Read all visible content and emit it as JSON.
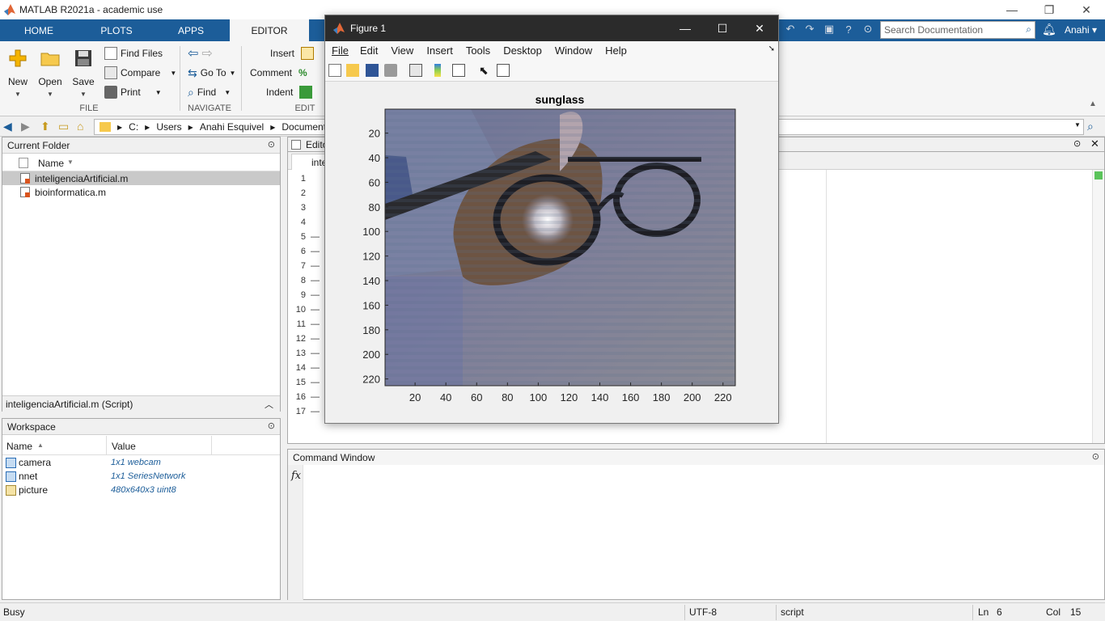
{
  "app": {
    "title": "MATLAB R2021a - academic use"
  },
  "window_controls": {
    "minimize": "—",
    "restore": "❐",
    "close": "✕"
  },
  "ribbon_tabs": [
    {
      "label": "HOME"
    },
    {
      "label": "PLOTS"
    },
    {
      "label": "APPS"
    },
    {
      "label": "EDITOR"
    }
  ],
  "search": {
    "placeholder": "Search Documentation"
  },
  "user": {
    "name": "Anahi",
    "caret": "▾"
  },
  "ribbon": {
    "file": {
      "new": "New",
      "open": "Open",
      "save": "Save",
      "find_files": "Find Files",
      "compare": "Compare",
      "print": "Print",
      "group": "FILE"
    },
    "navigate": {
      "go_to": "Go To",
      "find": "Find",
      "group": "NAVIGATE"
    },
    "edit": {
      "insert": "Insert",
      "comment": "Comment",
      "indent": "Indent",
      "group": "EDIT"
    }
  },
  "path": {
    "crumbs": [
      "C:",
      "Users",
      "Anahi Esquivel",
      "Documents"
    ]
  },
  "current_folder": {
    "title": "Current Folder",
    "column": "Name",
    "files": [
      {
        "name": "inteligenciaArtificial.m",
        "selected": true
      },
      {
        "name": "bioinformatica.m",
        "selected": false
      }
    ],
    "details": "inteligenciaArtificial.m  (Script)"
  },
  "editor": {
    "title": "Editor",
    "tab": "inte",
    "line_numbers": [
      "1",
      "2",
      "3",
      "4",
      "5",
      "6",
      "7",
      "8",
      "9",
      "10",
      "11",
      "12",
      "13",
      "14",
      "15",
      "16",
      "17"
    ],
    "dash_lines": [
      "5",
      "6",
      "7",
      "8",
      "9",
      "10",
      "11",
      "12",
      "13",
      "14",
      "15",
      "16",
      "17"
    ]
  },
  "workspace": {
    "title": "Workspace",
    "col_name": "Name",
    "col_value": "Value",
    "vars": [
      {
        "name": "camera",
        "value": "1x1 webcam"
      },
      {
        "name": "nnet",
        "value": "1x1 SeriesNetwork"
      },
      {
        "name": "picture",
        "value": "480x640x3 uint8"
      }
    ]
  },
  "figure": {
    "title": "Figure 1",
    "menu": [
      "File",
      "Edit",
      "View",
      "Insert",
      "Tools",
      "Desktop",
      "Window",
      "Help"
    ],
    "plot_title": "sunglass",
    "x_ticks": [
      "20",
      "40",
      "60",
      "80",
      "100",
      "120",
      "140",
      "160",
      "180",
      "200",
      "220"
    ],
    "y_ticks": [
      "20",
      "40",
      "60",
      "80",
      "100",
      "120",
      "140",
      "160",
      "180",
      "200",
      "220"
    ]
  },
  "command_window": {
    "title": "Command Window",
    "prompt_icon": "fx"
  },
  "status": {
    "left": "Busy",
    "encoding": "UTF-8",
    "type": "script",
    "ln_label": "Ln",
    "ln_value": "6",
    "col_label": "Col",
    "col_value": "15"
  },
  "colors": {
    "ribbon_tab_bg": "#1c5d99",
    "accent_orange": "#d9541e",
    "figure_titlebar": "#2b2b2b"
  }
}
